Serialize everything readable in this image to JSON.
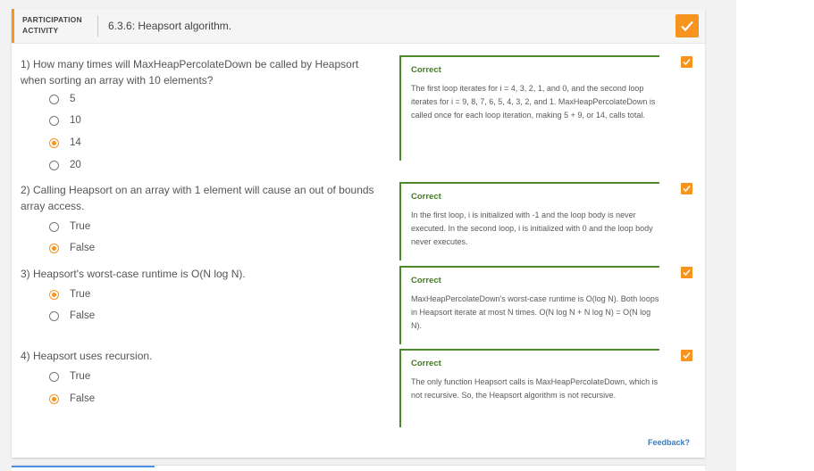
{
  "header": {
    "tag_line1": "PARTICIPATION",
    "tag_line2": "ACTIVITY",
    "title": "6.3.6: Heapsort algorithm."
  },
  "questions": [
    {
      "text": "1) How many times will MaxHeapPercolateDown be called by Heapsort when sorting an array with 10 elements?",
      "options": [
        "5",
        "10",
        "14",
        "20"
      ],
      "selected_index": 2,
      "feedback_title": "Correct",
      "feedback_text": "The first loop iterates for i = 4, 3, 2, 1, and 0, and the second loop iterates for i = 9, 8, 7, 6, 5, 4, 3, 2, and 1. MaxHeapPercolateDown is called once for each loop iteration, making 5 + 9, or 14, calls total."
    },
    {
      "text": "2) Calling Heapsort on an array with 1 element will cause an out of bounds array access.",
      "options": [
        "True",
        "False"
      ],
      "selected_index": 1,
      "feedback_title": "Correct",
      "feedback_text": "In the first loop, i is initialized with -1 and the loop body is never executed. In the second loop, i is initialized with 0 and the loop body never executes."
    },
    {
      "text": "3) Heapsort's worst-case runtime is O(N log N).",
      "options": [
        "True",
        "False"
      ],
      "selected_index": 0,
      "feedback_title": "Correct",
      "feedback_text": "MaxHeapPercolateDown's worst-case runtime is O(log N). Both loops in Heapsort iterate at most N times. O(N log N + N log N) = O(N log N)."
    },
    {
      "text": "4) Heapsort uses recursion.",
      "options": [
        "True",
        "False"
      ],
      "selected_index": 1,
      "feedback_title": "Correct",
      "feedback_text": "The only function Heapsort calls is MaxHeapPercolateDown, which is not recursive. So, the Heapsort algorithm is not recursive."
    }
  ],
  "feedback_link": "Feedback?",
  "colors": {
    "accent": "#f7941d",
    "correct": "#3f7d20",
    "link": "#3a7abf"
  }
}
